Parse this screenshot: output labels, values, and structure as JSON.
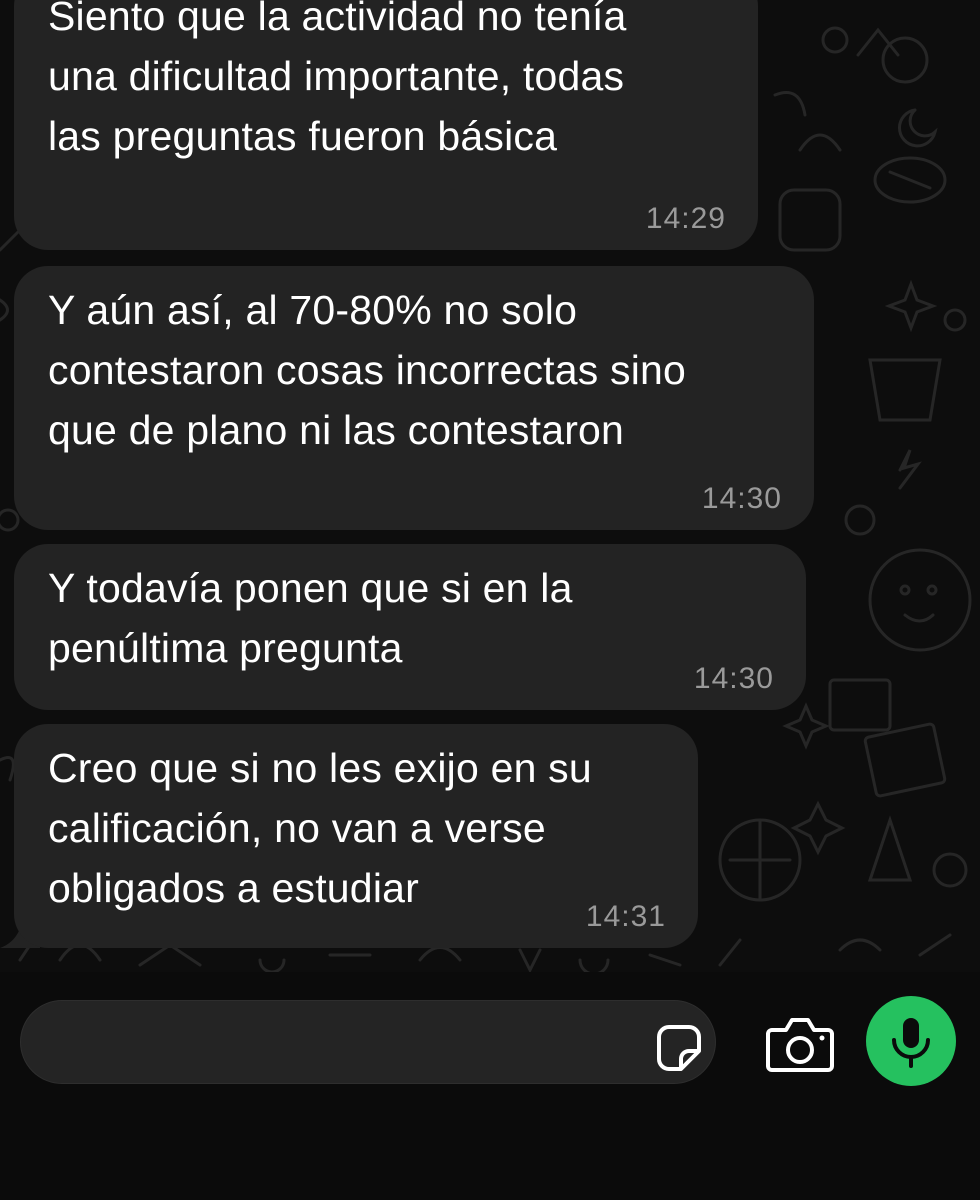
{
  "messages": [
    {
      "text": "Siento que la actividad no tenía\nuna dificultad importante, todas\nlas preguntas fueron básica",
      "time": "14:29"
    },
    {
      "text": "Y aún así, al 70-80% no solo\ncontestaron cosas incorrectas sino\nque de plano ni las contestaron",
      "time": "14:30"
    },
    {
      "text": "Y todavía ponen que si en la\npenúltima pregunta",
      "time": "14:30"
    },
    {
      "text": "Creo que si no les exijo en su\ncalificación, no van a verse\nobligados a estudiar",
      "time": "14:31"
    }
  ],
  "composer": {
    "input_value": "",
    "sticker_icon": "sticker-icon",
    "camera_icon": "camera-icon",
    "mic_icon": "microphone-icon",
    "mic_color": "#25c15f"
  },
  "colors": {
    "bubble": "#232323",
    "background": "#0d0d0d",
    "timestamp": "#9a9a9a"
  }
}
